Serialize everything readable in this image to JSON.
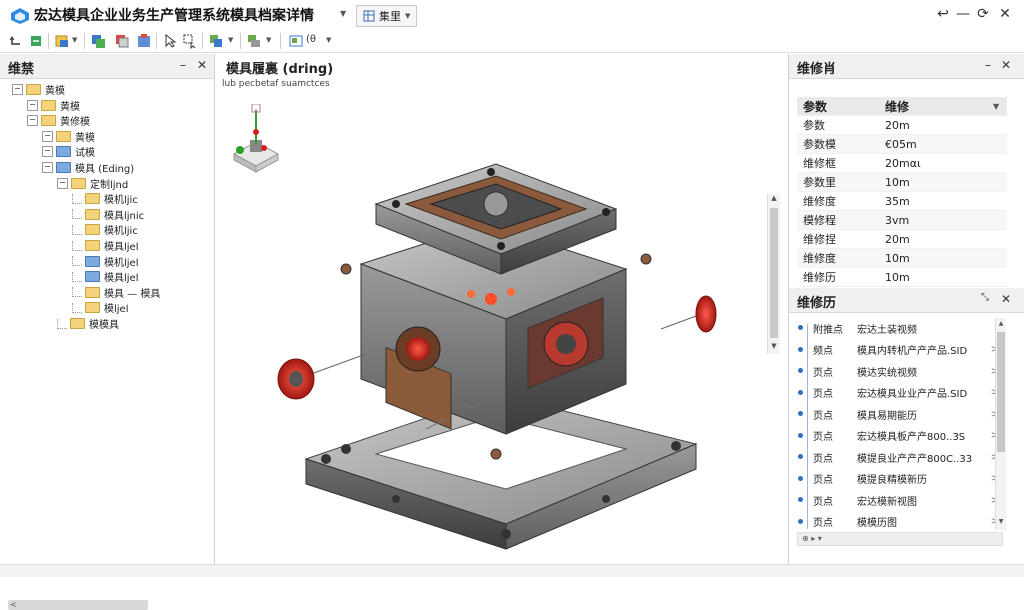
{
  "window": {
    "title": "宏达模具企业业务生产管理系统模具档案详情",
    "mode_label": "集里",
    "controls": [
      "↩",
      "—",
      "⟳",
      "✕"
    ]
  },
  "toolbar": {
    "view_text": "(θ"
  },
  "left_panel": {
    "title": "维禁",
    "items": [
      {
        "label": "黄模",
        "indent": 0,
        "exp": "-",
        "icon": "folder"
      },
      {
        "label": "黄模",
        "indent": 1,
        "exp": "-",
        "icon": "folder"
      },
      {
        "label": "黄修模",
        "indent": 1,
        "exp": "-",
        "icon": "folder"
      },
      {
        "label": "黄模",
        "indent": 2,
        "exp": "-",
        "icon": "folder"
      },
      {
        "label": "试模",
        "indent": 2,
        "exp": "-",
        "icon": "folder-blue"
      },
      {
        "label": "模具 (Eding)",
        "indent": 2,
        "exp": "-",
        "icon": "folder-blue"
      },
      {
        "label": "定制ljnd",
        "indent": 3,
        "exp": "-",
        "icon": "folder"
      },
      {
        "label": "模机ljic",
        "indent": 4,
        "exp": "",
        "icon": "folder"
      },
      {
        "label": "模具ljnic",
        "indent": 4,
        "exp": "",
        "icon": "folder"
      },
      {
        "label": "模机ljic",
        "indent": 4,
        "exp": "",
        "icon": "folder"
      },
      {
        "label": "模具ljel",
        "indent": 4,
        "exp": "",
        "icon": "folder"
      },
      {
        "label": "模机ljel",
        "indent": 4,
        "exp": "",
        "icon": "folder-blue"
      },
      {
        "label": "模具ljel",
        "indent": 4,
        "exp": "",
        "icon": "folder-blue"
      },
      {
        "label": "模具 — 模具",
        "indent": 4,
        "exp": "",
        "icon": "folder"
      },
      {
        "label": "模ljel",
        "indent": 4,
        "exp": "",
        "icon": "folder"
      },
      {
        "label": "模模具",
        "indent": 3,
        "exp": "",
        "icon": "folder"
      }
    ],
    "scroll_label": "<"
  },
  "viewport": {
    "title": "模具履裏 (dring)",
    "subtitle": "lub pecbetaf suamctces"
  },
  "props_panel": {
    "title": "维修肖",
    "head_key": "参数",
    "head_val": "维修",
    "rows": [
      {
        "k": "参数",
        "v": "20m"
      },
      {
        "k": "参数模",
        "v": "€05m"
      },
      {
        "k": "维修框",
        "v": "20mαι"
      },
      {
        "k": "参数里",
        "v": "10m"
      },
      {
        "k": "维修度",
        "v": "35m"
      },
      {
        "k": "模修程",
        "v": "3vm"
      },
      {
        "k": "维修捏",
        "v": "20m"
      },
      {
        "k": "维修度",
        "v": "10m"
      },
      {
        "k": "维修历",
        "v": "10m"
      }
    ]
  },
  "history_panel": {
    "title": "维修历",
    "items": [
      {
        "label": "附推点",
        "text": "宏达土装视频",
        "arrow": ""
      },
      {
        "label": "频点",
        "text": "模具内转机产产产品.SID",
        "arrow": ">"
      },
      {
        "label": "页点",
        "text": "模达实统视频",
        "arrow": ">"
      },
      {
        "label": "页点",
        "text": "宏达模具业业产产品.SID",
        "arrow": ">"
      },
      {
        "label": "页点",
        "text": "模具易期能历",
        "arrow": ">"
      },
      {
        "label": "页点",
        "text": "宏达模具板产产800..3S",
        "arrow": ">"
      },
      {
        "label": "页点",
        "text": "模提良业产产产800C..33",
        "arrow": ">"
      },
      {
        "label": "页点",
        "text": "模提良精模新历",
        "arrow": ">"
      },
      {
        "label": "页点",
        "text": "宏达模新视图",
        "arrow": ">"
      },
      {
        "label": "页点",
        "text": "模模历图",
        "arrow": ">"
      }
    ]
  }
}
